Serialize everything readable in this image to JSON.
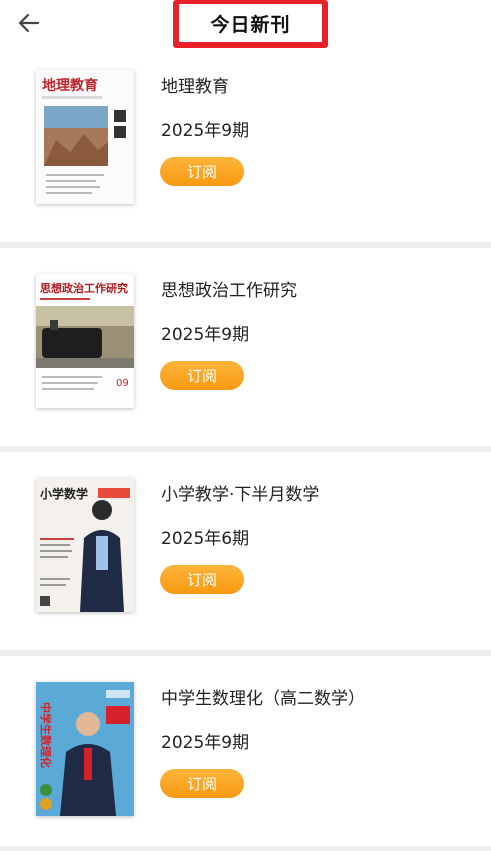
{
  "header": {
    "title": "今日新刊",
    "back_icon": "arrow-left-icon"
  },
  "magazines": [
    {
      "name": "地理教育",
      "issue": "2025年9期",
      "button_label": "订阅",
      "cover_title": "地理教育",
      "cover_issue": ""
    },
    {
      "name": "思想政治工作研究",
      "issue": "2025年9期",
      "button_label": "订阅",
      "cover_title": "思想政治工作研究",
      "cover_issue": "09"
    },
    {
      "name": "小学教学·下半月数学",
      "issue": "2025年6期",
      "button_label": "订阅",
      "cover_title": "小学数学",
      "cover_issue": ""
    },
    {
      "name": "中学生数理化（高二数学）",
      "issue": "2025年9期",
      "button_label": "订阅",
      "cover_title": "中学生数理化",
      "cover_issue": ""
    }
  ],
  "colors": {
    "accent": "#f79a12",
    "annotation": "#e8202a",
    "separator": "#efefef"
  }
}
